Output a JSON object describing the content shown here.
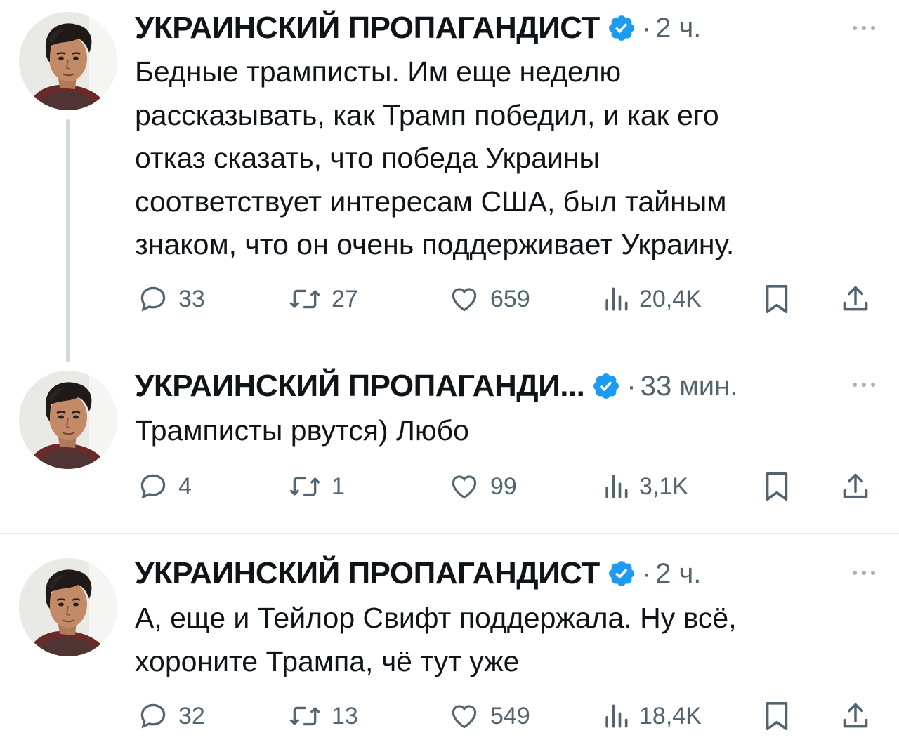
{
  "colors": {
    "verified": "#1d9bf0",
    "muted": "#536471",
    "text": "#0f1419",
    "divider": "#e7e9ea"
  },
  "icons": [
    "reply-icon",
    "retweet-icon",
    "like-icon",
    "views-icon",
    "bookmark-icon",
    "share-icon",
    "verified-badge-icon",
    "more-icon"
  ],
  "tweets": [
    {
      "name": "УКРАИНСКИЙ ПРОПАГАНДИСТ",
      "separator": "·",
      "time": "2 ч.",
      "lines": [
        "Бедные трамписты. Им еще неделю",
        "рассказывать, как Трамп победил, и как его",
        "отказ сказать, что победа Украины",
        "соответствует интересам США, был тайным",
        "знаком, что он очень поддерживает Украину."
      ],
      "replies": "33",
      "retweets": "27",
      "likes": "659",
      "views": "20,4K"
    },
    {
      "name": "УКРАИНСКИЙ ПРОПАГАНДИ...",
      "separator": "·",
      "time": "33 мин.",
      "lines": [
        "Трамписты рвутся) Любо"
      ],
      "replies": "4",
      "retweets": "1",
      "likes": "99",
      "views": "3,1K"
    },
    {
      "name": "УКРАИНСКИЙ ПРОПАГАНДИСТ",
      "separator": "·",
      "time": "2 ч.",
      "lines": [
        "А, еще и Тейлор Свифт поддержала. Ну всё,",
        "хороните Трампа, чё тут уже"
      ],
      "replies": "32",
      "retweets": "13",
      "likes": "549",
      "views": "18,4K"
    }
  ]
}
